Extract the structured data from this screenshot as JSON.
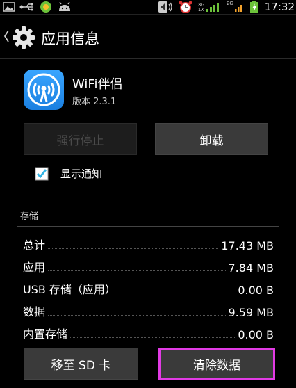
{
  "status_bar": {
    "time": "17:32",
    "network_top": "3G",
    "network_bottom": "1X",
    "network2": "2G"
  },
  "action_bar": {
    "title": "应用信息"
  },
  "app": {
    "name": "WiFi伴侣",
    "version": "版本 2.3.1"
  },
  "buttons": {
    "force_stop": "强行停止",
    "uninstall": "卸载",
    "move_to_sd": "移至 SD 卡",
    "clear_data": "清除数据"
  },
  "notification_checkbox": {
    "label": "显示通知",
    "checked": true
  },
  "storage": {
    "header": "存储",
    "rows": [
      {
        "label": "总计",
        "value": "17.43 MB"
      },
      {
        "label": "应用",
        "value": "7.84 MB"
      },
      {
        "label": "USB 存储（应用）",
        "value": "0.00 B"
      },
      {
        "label": "数据",
        "value": "9.59 MB"
      },
      {
        "label": "内置存储",
        "value": "0.00 B"
      }
    ]
  },
  "colors": {
    "accent": "#33b5e5",
    "highlight_border": "#e23be4",
    "app_icon_blue": "#2a94f4"
  }
}
